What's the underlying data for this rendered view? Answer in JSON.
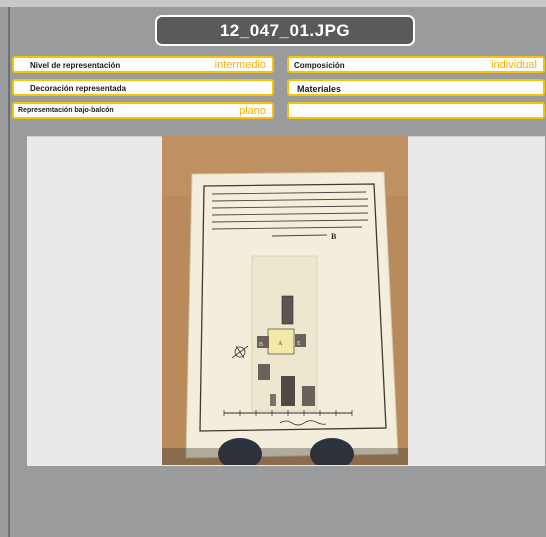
{
  "title": "12_047_01.JPG",
  "fields": {
    "nivel": {
      "label": "Nivel de representación",
      "value": "intermedio"
    },
    "composicion": {
      "label": "Composición",
      "value": "individual"
    },
    "decoracion": {
      "label": "Decoración representada",
      "value": ""
    },
    "materiales": {
      "label": "Materiales",
      "value": ""
    },
    "bajo_balcon": {
      "label": "Represemtación bajo-balcón",
      "value": "plano"
    },
    "empty": {
      "label": "",
      "value": ""
    }
  },
  "document_caption": "B",
  "plan_labels": [
    "B",
    "A",
    "E"
  ],
  "colors": {
    "accent": "#f6c400",
    "value_text": "#f4b400",
    "title_bg": "#5a5a5c",
    "page_bg": "#9a9b9d"
  }
}
